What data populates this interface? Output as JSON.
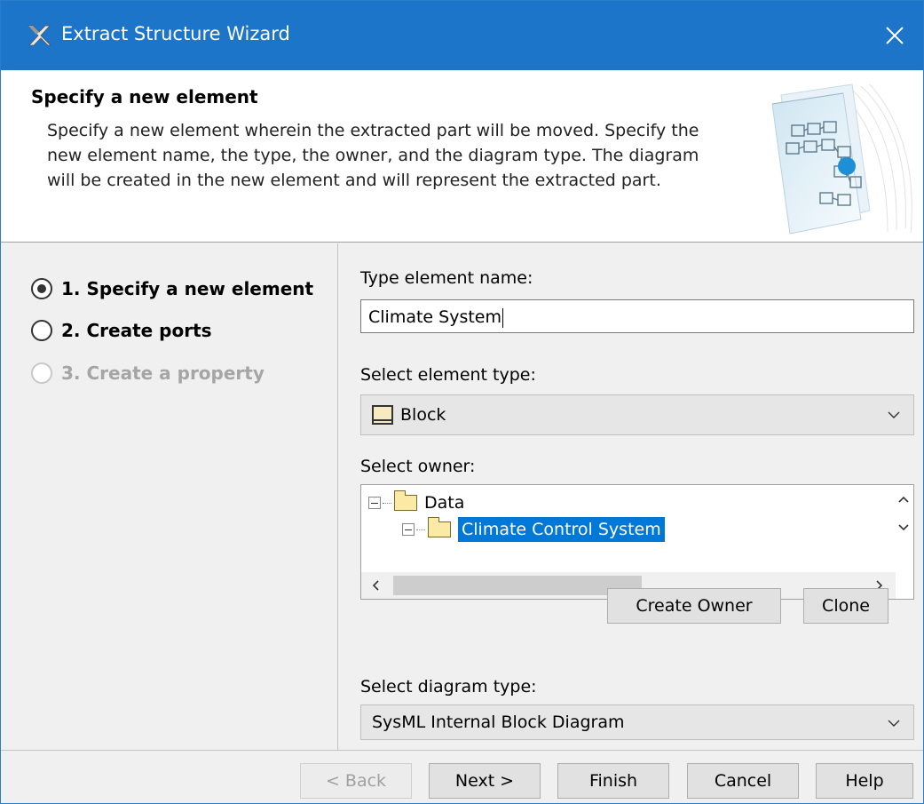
{
  "window": {
    "title": "Extract Structure Wizard",
    "close_glyph": "✕",
    "app_icon": "magic-draw-icon"
  },
  "header": {
    "title": "Specify a new element",
    "description": "Specify a new element wherein the extracted part will be moved. Specify the new element name, the type, the owner, and the diagram type. The diagram will be created in the new element and will represent the extracted part.",
    "graphic": "wizard-diagram-illustration"
  },
  "steps": [
    {
      "label": "1. Specify a new element",
      "state": "current"
    },
    {
      "label": "2. Create ports",
      "state": "enabled"
    },
    {
      "label": "3. Create a property",
      "state": "disabled"
    }
  ],
  "form": {
    "name_label": "Type element name:",
    "name_value": "Climate System",
    "type_label": "Select element type:",
    "type_value": "Block",
    "owner_label": "Select owner:",
    "owner_tree": [
      {
        "label": "Data",
        "level": 0,
        "selected": false
      },
      {
        "label": "Climate Control System",
        "level": 1,
        "selected": true
      }
    ],
    "create_owner_label": "Create Owner",
    "clone_label": "Clone",
    "diagram_label": "Select diagram type:",
    "diagram_value": "SysML Internal Block Diagram"
  },
  "footer": {
    "back_label": "< Back",
    "next_label": "Next >",
    "finish_label": "Finish",
    "cancel_label": "Cancel",
    "help_label": "Help"
  },
  "colors": {
    "titlebar": "#1c75c8",
    "selection": "#0078d7",
    "block_fill": "#f7eac0",
    "folder_fill": "#fbe9a6"
  }
}
